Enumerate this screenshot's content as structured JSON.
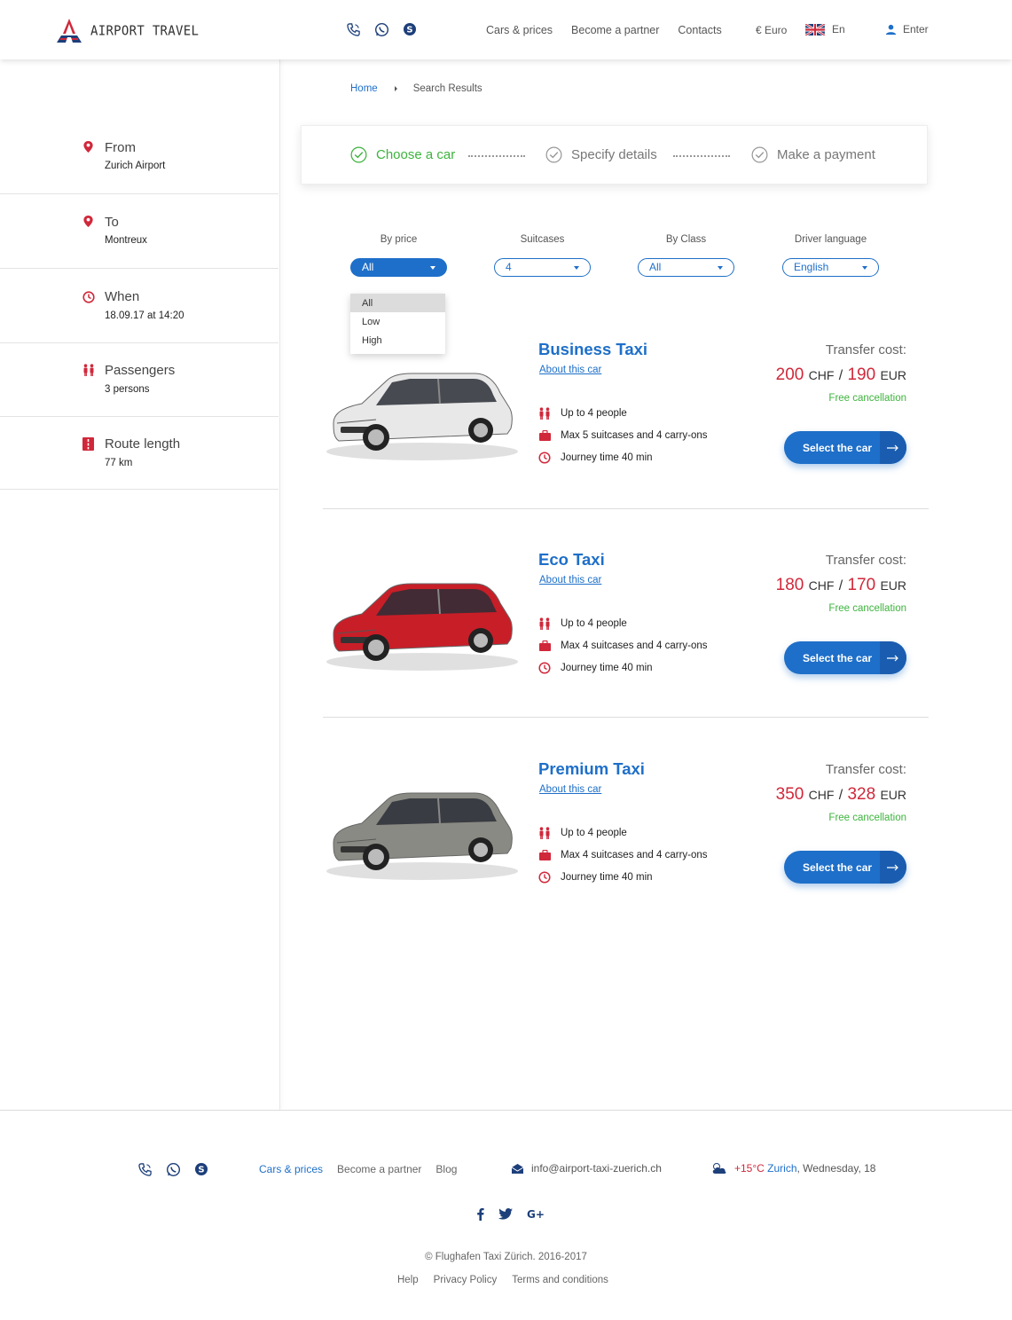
{
  "header": {
    "logo_text": "AIRPORT TRAVEL",
    "nav": [
      "Cars & prices",
      "Become a partner",
      "Contacts"
    ],
    "currency": "€ Euro",
    "language": "En",
    "enter": "Enter"
  },
  "sidebar": {
    "items": [
      {
        "label": "From",
        "value": "Zurich Airport",
        "icon": "location-pin-icon"
      },
      {
        "label": "To",
        "value": "Montreux",
        "icon": "location-pin-icon"
      },
      {
        "label": "When",
        "value": "18.09.17 at 14:20",
        "icon": "clock-icon"
      },
      {
        "label": "Passengers",
        "value": "3 persons",
        "icon": "people-icon"
      },
      {
        "label": "Route length",
        "value": "77 km",
        "icon": "road-icon"
      }
    ]
  },
  "breadcrumb": {
    "home": "Home",
    "current": "Search Results"
  },
  "steps": [
    {
      "label": "Choose a car",
      "state": "active"
    },
    {
      "label": "Specify details",
      "state": "pending"
    },
    {
      "label": "Make a payment",
      "state": "pending"
    }
  ],
  "filters": [
    {
      "title": "By price",
      "value": "All"
    },
    {
      "title": "Suitcases",
      "value": "4"
    },
    {
      "title": "By Class",
      "value": "All"
    },
    {
      "title": "Driver language",
      "value": "English"
    }
  ],
  "price_dropdown": {
    "options": [
      "All",
      "Low",
      "High"
    ],
    "selected": "All"
  },
  "cars": [
    {
      "title": "Business Taxi",
      "about": "About this car",
      "features": [
        "Up to 4 people",
        "Max 5 suitcases and 4 carry-ons",
        "Journey time 40 min"
      ],
      "cost_label": "Transfer cost:",
      "chf": "200",
      "chf_unit": "CHF",
      "eur": "190",
      "eur_unit": "EUR",
      "free": "Free cancellation",
      "button": "Select the car",
      "color": "#e8e8e8"
    },
    {
      "title": "Eco Taxi",
      "about": "About this car",
      "features": [
        "Up to 4 people",
        "Max 4 suitcases and 4 carry-ons",
        "Journey time 40 min"
      ],
      "cost_label": "Transfer cost:",
      "chf": "180",
      "chf_unit": "CHF",
      "eur": "170",
      "eur_unit": "EUR",
      "free": "Free cancellation",
      "button": "Select the car",
      "color": "#c81e28"
    },
    {
      "title": "Premium Taxi",
      "about": "About this car",
      "features": [
        "Up to 4 people",
        "Max 4 suitcases and 4 carry-ons",
        "Journey time 40 min"
      ],
      "cost_label": "Transfer cost:",
      "chf": "350",
      "chf_unit": "CHF",
      "eur": "328",
      "eur_unit": "EUR",
      "free": "Free cancellation",
      "button": "Select the car",
      "color": "#8a8a84"
    }
  ],
  "footer": {
    "nav": [
      "Cars & prices",
      "Become a partner",
      "Blog"
    ],
    "email": "info@airport-taxi-zuerich.ch",
    "temp": "+15°C",
    "city": "Zurich",
    "date": ", Wednesday, 18",
    "copyright": "© Flughafen Taxi Zürich. 2016-2017",
    "links": [
      "Help",
      "Privacy Policy",
      "Terms and conditions"
    ]
  },
  "colors": {
    "accent": "#1e6fc9",
    "red": "#d0283a",
    "green": "#3db33d"
  }
}
